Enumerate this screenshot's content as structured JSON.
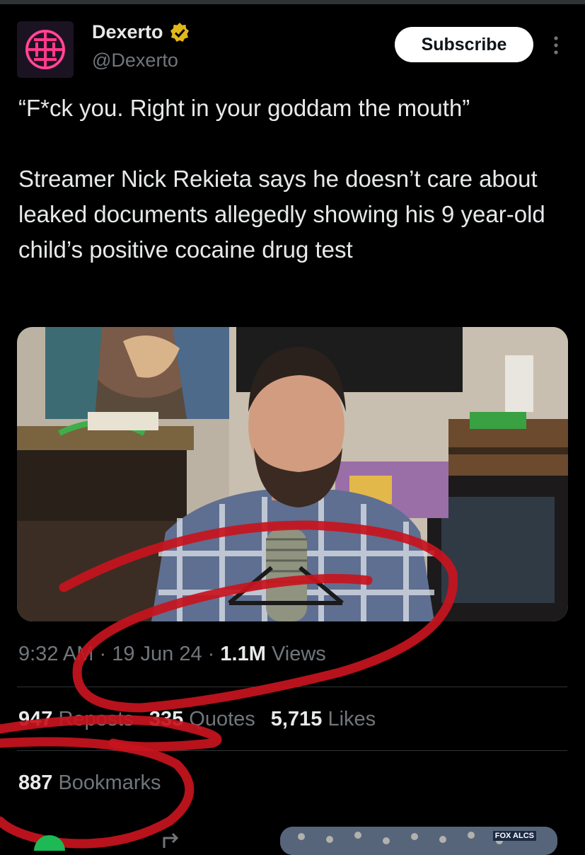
{
  "author": {
    "display_name": "Dexerto",
    "handle": "@Dexerto",
    "verified_badge": "gold-verified-icon"
  },
  "subscribe_label": "Subscribe",
  "tweet": {
    "text": "“F*ck you. Right in your goddam the mouth”\n\nStreamer Nick Rekieta says he doesn’t care about leaked documents allegedly showing his 9 year-old child’s positive cocaine drug test"
  },
  "meta": {
    "time": "9:32 AM",
    "date": "19 Jun 24",
    "views_count": "1.1M",
    "views_label": "Views",
    "separator": "·"
  },
  "stats": {
    "reposts_count": "947",
    "reposts_label": "Reposts",
    "quotes_count": "335",
    "quotes_label": "Quotes",
    "likes_count": "5,715",
    "likes_label": "Likes",
    "bookmarks_count": "887",
    "bookmarks_label": "Bookmarks"
  },
  "ad_badge": "FOX ALCS",
  "colors": {
    "background": "#000000",
    "text": "#e7e9ea",
    "secondary": "#71767b",
    "verified": "#e2b719",
    "annotation_red": "#c8141e"
  }
}
